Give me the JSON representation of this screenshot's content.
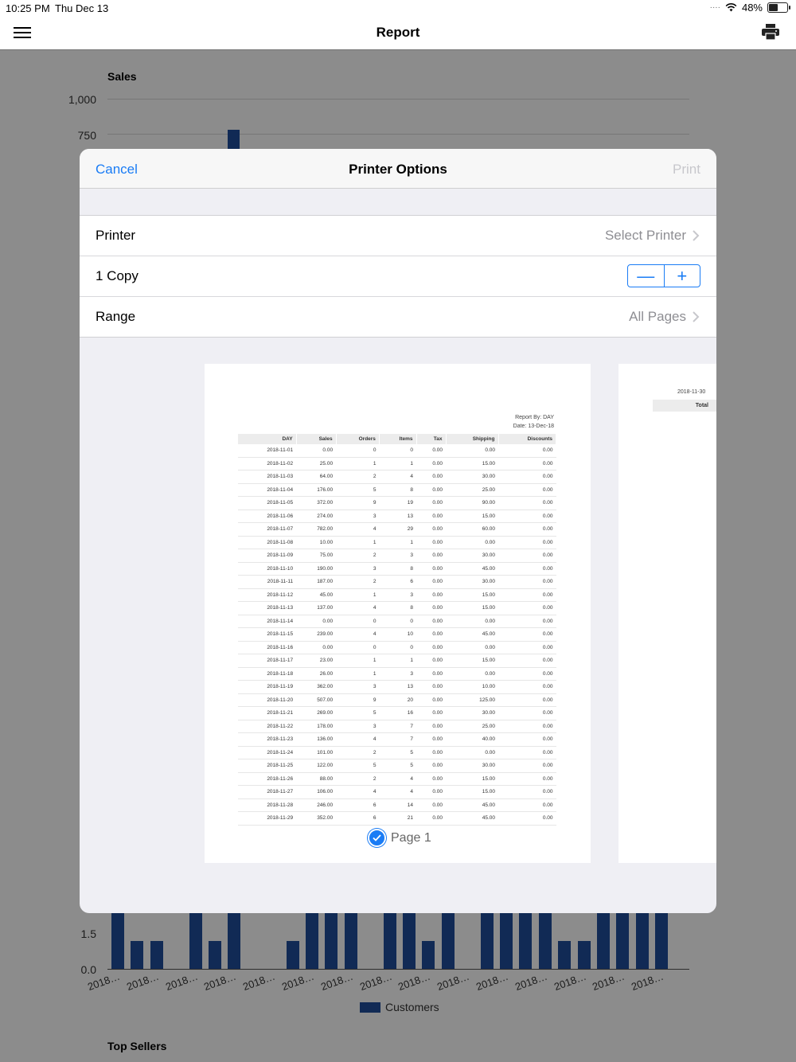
{
  "status": {
    "time": "10:25 PM",
    "date": "Thu Dec 13",
    "battery": "48%",
    "battery_level": 0.48
  },
  "nav": {
    "title": "Report"
  },
  "background": {
    "sales_title": "Sales",
    "sales_ticks": [
      "1,000",
      "750"
    ],
    "customers_ticks": [
      "1.5",
      "0.0"
    ],
    "x_labels": [
      "2018…",
      "2018…",
      "2018…",
      "2018…",
      "2018…",
      "2018…",
      "2018…",
      "2018…",
      "2018…",
      "2018…",
      "2018…",
      "2018…",
      "2018…",
      "2018…",
      "2018…"
    ],
    "legend": "Customers",
    "top_sellers": "Top Sellers"
  },
  "chart_data": {
    "type": "bar",
    "series": [
      {
        "name": "Customers",
        "values": [
          2,
          1,
          1,
          0,
          2,
          1,
          2,
          0,
          0,
          1,
          2,
          2,
          2,
          0,
          2,
          2,
          1,
          2,
          0,
          2,
          2,
          2,
          2,
          1,
          1,
          2,
          2,
          2,
          2
        ]
      }
    ],
    "ylim": [
      0,
      2
    ]
  },
  "dialog": {
    "cancel": "Cancel",
    "title": "Printer Options",
    "print": "Print",
    "printer_label": "Printer",
    "printer_value": "Select Printer",
    "copies_label": "1 Copy",
    "stepper_minus": "—",
    "stepper_plus": "+",
    "range_label": "Range",
    "range_value": "All Pages",
    "page_label": "Page 1"
  },
  "report": {
    "by": "Report By: DAY",
    "date": "Date: 13-Dec-18",
    "columns": [
      "DAY",
      "Sales",
      "Orders",
      "Items",
      "Tax",
      "Shipping",
      "Discounts"
    ],
    "rows": [
      [
        "2018-11-01",
        "0.00",
        "0",
        "0",
        "0.00",
        "0.00",
        "0.00"
      ],
      [
        "2018-11-02",
        "25.00",
        "1",
        "1",
        "0.00",
        "15.00",
        "0.00"
      ],
      [
        "2018-11-03",
        "64.00",
        "2",
        "4",
        "0.00",
        "30.00",
        "0.00"
      ],
      [
        "2018-11-04",
        "176.00",
        "5",
        "8",
        "0.00",
        "25.00",
        "0.00"
      ],
      [
        "2018-11-05",
        "372.00",
        "9",
        "19",
        "0.00",
        "90.00",
        "0.00"
      ],
      [
        "2018-11-06",
        "274.00",
        "3",
        "13",
        "0.00",
        "15.00",
        "0.00"
      ],
      [
        "2018-11-07",
        "782.00",
        "4",
        "29",
        "0.00",
        "60.00",
        "0.00"
      ],
      [
        "2018-11-08",
        "10.00",
        "1",
        "1",
        "0.00",
        "0.00",
        "0.00"
      ],
      [
        "2018-11-09",
        "75.00",
        "2",
        "3",
        "0.00",
        "30.00",
        "0.00"
      ],
      [
        "2018-11-10",
        "190.00",
        "3",
        "8",
        "0.00",
        "45.00",
        "0.00"
      ],
      [
        "2018-11-11",
        "187.00",
        "2",
        "6",
        "0.00",
        "30.00",
        "0.00"
      ],
      [
        "2018-11-12",
        "45.00",
        "1",
        "3",
        "0.00",
        "15.00",
        "0.00"
      ],
      [
        "2018-11-13",
        "137.00",
        "4",
        "8",
        "0.00",
        "15.00",
        "0.00"
      ],
      [
        "2018-11-14",
        "0.00",
        "0",
        "0",
        "0.00",
        "0.00",
        "0.00"
      ],
      [
        "2018-11-15",
        "239.00",
        "4",
        "10",
        "0.00",
        "45.00",
        "0.00"
      ],
      [
        "2018-11-16",
        "0.00",
        "0",
        "0",
        "0.00",
        "0.00",
        "0.00"
      ],
      [
        "2018-11-17",
        "23.00",
        "1",
        "1",
        "0.00",
        "15.00",
        "0.00"
      ],
      [
        "2018-11-18",
        "26.00",
        "1",
        "3",
        "0.00",
        "0.00",
        "0.00"
      ],
      [
        "2018-11-19",
        "362.00",
        "3",
        "13",
        "0.00",
        "10.00",
        "0.00"
      ],
      [
        "2018-11-20",
        "507.00",
        "9",
        "20",
        "0.00",
        "125.00",
        "0.00"
      ],
      [
        "2018-11-21",
        "269.00",
        "5",
        "16",
        "0.00",
        "30.00",
        "0.00"
      ],
      [
        "2018-11-22",
        "178.00",
        "3",
        "7",
        "0.00",
        "25.00",
        "0.00"
      ],
      [
        "2018-11-23",
        "136.00",
        "4",
        "7",
        "0.00",
        "40.00",
        "0.00"
      ],
      [
        "2018-11-24",
        "101.00",
        "2",
        "5",
        "0.00",
        "0.00",
        "0.00"
      ],
      [
        "2018-11-25",
        "122.00",
        "5",
        "5",
        "0.00",
        "30.00",
        "0.00"
      ],
      [
        "2018-11-26",
        "88.00",
        "2",
        "4",
        "0.00",
        "15.00",
        "0.00"
      ],
      [
        "2018-11-27",
        "106.00",
        "4",
        "4",
        "0.00",
        "15.00",
        "0.00"
      ],
      [
        "2018-11-28",
        "246.00",
        "6",
        "14",
        "0.00",
        "45.00",
        "0.00"
      ],
      [
        "2018-11-29",
        "352.00",
        "6",
        "21",
        "0.00",
        "45.00",
        "0.00"
      ]
    ],
    "page2_date": "2018-11-30",
    "page2_total": "Total"
  }
}
